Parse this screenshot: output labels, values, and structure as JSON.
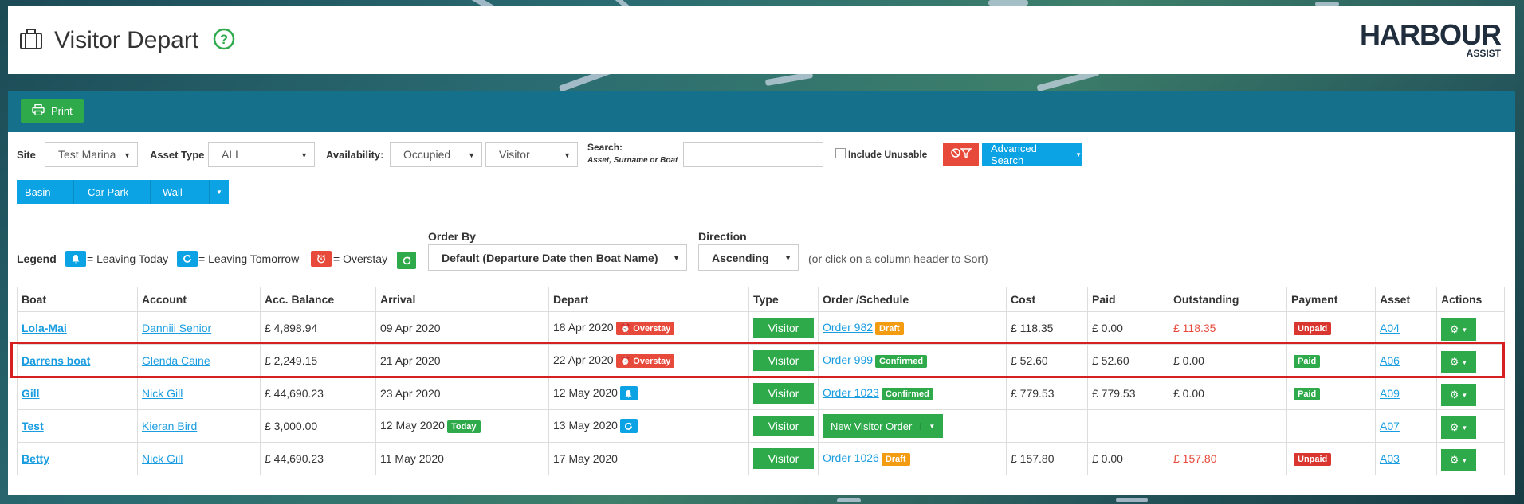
{
  "header": {
    "title": "Visitor Depart",
    "logo_main": "HARBOUR",
    "logo_sub": "ASSIST"
  },
  "toolbar": {
    "print_label": "Print"
  },
  "filters": {
    "site_label": "Site",
    "site_value": "Test Marina",
    "asset_type_label": "Asset Type",
    "asset_type_value": "ALL",
    "availability_label": "Availability:",
    "availability_value": "Occupied",
    "visitor_value": "Visitor",
    "search_label": "Search:",
    "search_hint": "Asset, Surname or Boat",
    "search_value": "",
    "include_unusable_label": "Include Unusable",
    "advanced_search_label": "Advanced Search",
    "asset_buttons": [
      "Basin",
      "Car Park",
      "Wall"
    ]
  },
  "legend": {
    "label": "Legend",
    "leaving_today": "= Leaving Today",
    "leaving_tomorrow": "= Leaving Tomorrow",
    "overstay": "= Overstay"
  },
  "sort": {
    "order_by_label": "Order By",
    "order_by_value": "Default (Departure Date then Boat Name)",
    "direction_label": "Direction",
    "direction_value": "Ascending",
    "hint": "(or click on a column header to Sort)"
  },
  "table": {
    "headers": [
      "Boat",
      "Account",
      "Acc. Balance",
      "Arrival",
      "Depart",
      "Type",
      "Order /Schedule",
      "Cost",
      "Paid",
      "Outstanding",
      "Payment",
      "Asset",
      "Actions"
    ],
    "rows": [
      {
        "boat": "Lola-Mai",
        "account": "Danniii Senior",
        "balance": "£ 4,898.94",
        "arrival": "09 Apr 2020",
        "depart": "18 Apr 2020",
        "depart_badge": "Overstay",
        "type": "Visitor",
        "order": "Order 982",
        "order_badge": "Draft",
        "cost": "£ 118.35",
        "paid": "£ 0.00",
        "outstanding": "£ 118.35",
        "payment": "Unpaid",
        "asset": "A04"
      },
      {
        "boat": "Darrens boat",
        "account": "Glenda Caine",
        "balance": "£ 2,249.15",
        "arrival": "21 Apr 2020",
        "depart": "22 Apr 2020",
        "depart_badge": "Overstay",
        "type": "Visitor",
        "order": "Order 999",
        "order_badge": "Confirmed",
        "cost": "£ 52.60",
        "paid": "£ 52.60",
        "outstanding": "£ 0.00",
        "payment": "Paid",
        "asset": "A06"
      },
      {
        "boat": "Gill",
        "account": "Nick Gill",
        "balance": "£ 44,690.23",
        "arrival": "23 Apr 2020",
        "depart": "12 May 2020",
        "type": "Visitor",
        "order": "Order 1023",
        "order_badge": "Confirmed",
        "cost": "£ 779.53",
        "paid": "£ 779.53",
        "outstanding": "£ 0.00",
        "payment": "Paid",
        "asset": "A09"
      },
      {
        "boat": "Test",
        "account": "Kieran Bird",
        "balance": "£ 3,000.00",
        "arrival": "12 May 2020",
        "arrival_badge": "Today",
        "depart": "13 May 2020",
        "type": "Visitor",
        "new_order_label": "New Visitor Order",
        "cost": "",
        "paid": "",
        "outstanding": "",
        "payment": "",
        "asset": "A07"
      },
      {
        "boat": "Betty",
        "account": "Nick Gill",
        "balance": "£ 44,690.23",
        "arrival": "11 May 2020",
        "depart": "17 May 2020",
        "type": "Visitor",
        "order": "Order 1026",
        "order_badge": "Draft",
        "cost": "£ 157.80",
        "paid": "£ 0.00",
        "outstanding": "£ 157.80",
        "payment": "Unpaid",
        "asset": "A03"
      }
    ]
  },
  "colors": {
    "teal_toolbar": "#15708b",
    "green": "#2eaa4b",
    "blue": "#0ba3e4",
    "red": "#e74a3b",
    "orange": "#f39c12",
    "link": "#1a9de0"
  },
  "icons": {
    "title": "briefcase-icon",
    "help": "question-circle-icon",
    "print": "printer-icon",
    "leaving_today": "bell-icon",
    "leaving_tomorrow": "refresh-icon",
    "overstay": "alarm-clock-icon",
    "actions": "gear-icon"
  }
}
